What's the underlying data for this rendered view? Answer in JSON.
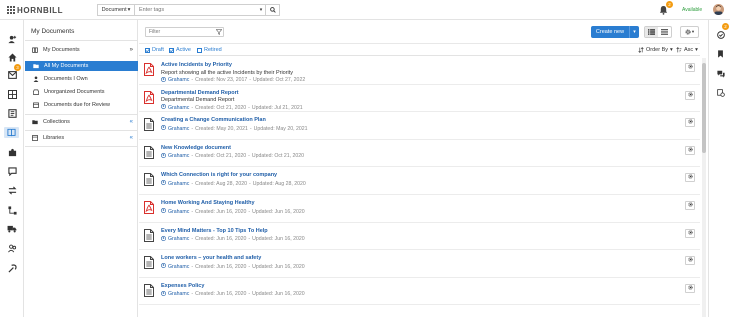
{
  "header": {
    "logo_text": "HORNBILL",
    "search_type": "Document",
    "search_placeholder": "Enter tags",
    "notifications_count": "2",
    "status": "Available"
  },
  "leftnav": {
    "badge_count": "3",
    "icons": [
      "user-plus-icon",
      "home-icon",
      "inbox-icon",
      "grid-icon",
      "book-icon",
      "document-icon",
      "puzzle-icon",
      "chat-icon",
      "swap-icon",
      "workflow-icon",
      "truck-icon",
      "people-icon",
      "tools-icon",
      "sitemap-icon"
    ]
  },
  "rightrail": {
    "badge_count": "2",
    "icons": [
      "check-circle-icon",
      "bookmark-icon",
      "chat-bubbles-icon",
      "activity-icon"
    ]
  },
  "sidepanel": {
    "title": "My Documents",
    "sections": [
      {
        "label": "My Documents",
        "icon": "book-icon",
        "chevron": "»"
      },
      {
        "label": "All My Documents",
        "icon": "folder-icon",
        "active": true
      },
      {
        "label": "Documents I Own",
        "icon": "user-icon"
      },
      {
        "label": "Unorganized Documents",
        "icon": "inbox-icon"
      },
      {
        "label": "Documents due for Review",
        "icon": "calendar-icon"
      },
      {
        "label": "Collections",
        "icon": "folder-icon",
        "chevron": "«"
      },
      {
        "label": "Libraries",
        "icon": "library-icon",
        "chevron": "«"
      }
    ]
  },
  "toolbar": {
    "filter_placeholder": "Filter",
    "create_label": "Create new",
    "checks": [
      "Draft",
      "Active",
      "Retired"
    ],
    "order_by": "Order By",
    "order_dir": "Asc"
  },
  "documents": [
    {
      "title": "Active Incidents by Priority",
      "desc": "Report showing all the active Incidents by their Priority",
      "author": "Grahamc",
      "created": "Created: Nov 23, 2017",
      "updated": "Updated: Oct 27, 2022",
      "type": "pdf"
    },
    {
      "title": "Departmental Demand Report",
      "desc": "Departmental Demand Report",
      "author": "Grahamc",
      "created": "Created: Oct 21, 2020",
      "updated": "Updated: Jul 21, 2021",
      "type": "pdf"
    },
    {
      "title": "Creating a Change Communication Plan",
      "desc": "",
      "author": "Grahamc",
      "created": "Created: May 20, 2021",
      "updated": "Updated: May 20, 2021",
      "type": "doc"
    },
    {
      "title": "New Knowledge document",
      "desc": "",
      "author": "Grahamc",
      "created": "Created: Oct 21, 2020",
      "updated": "Updated: Oct 21, 2020",
      "type": "doc"
    },
    {
      "title": "Which Connection is right for your company",
      "desc": "",
      "author": "Grahamc",
      "created": "Created: Aug 28, 2020",
      "updated": "Updated: Aug 28, 2020",
      "type": "doc"
    },
    {
      "title": "Home Working And Staying Healthy",
      "desc": "",
      "author": "Grahamc",
      "created": "Created: Jun 16, 2020",
      "updated": "Updated: Jun 16, 2020",
      "type": "pdf"
    },
    {
      "title": "Every Mind Matters - Top 10 Tips To Help",
      "desc": "",
      "author": "Grahamc",
      "created": "Created: Jun 16, 2020",
      "updated": "Updated: Jun 16, 2020",
      "type": "doc"
    },
    {
      "title": "Lone workers – your health and safety",
      "desc": "",
      "author": "Grahamc",
      "created": "Created: Jun 16, 2020",
      "updated": "Updated: Jun 16, 2020",
      "type": "doc"
    },
    {
      "title": "Expenses Policy",
      "desc": "",
      "author": "Grahamc",
      "created": "Created: Jun 16, 2020",
      "updated": "Updated: Jun 16, 2020",
      "type": "doc"
    }
  ],
  "colors": {
    "accent": "#2a7dd1",
    "title_link": "#1f5ea8",
    "pdf_red": "#d9302c",
    "badge": "#f39c12",
    "status_green": "#2e9e3e"
  }
}
